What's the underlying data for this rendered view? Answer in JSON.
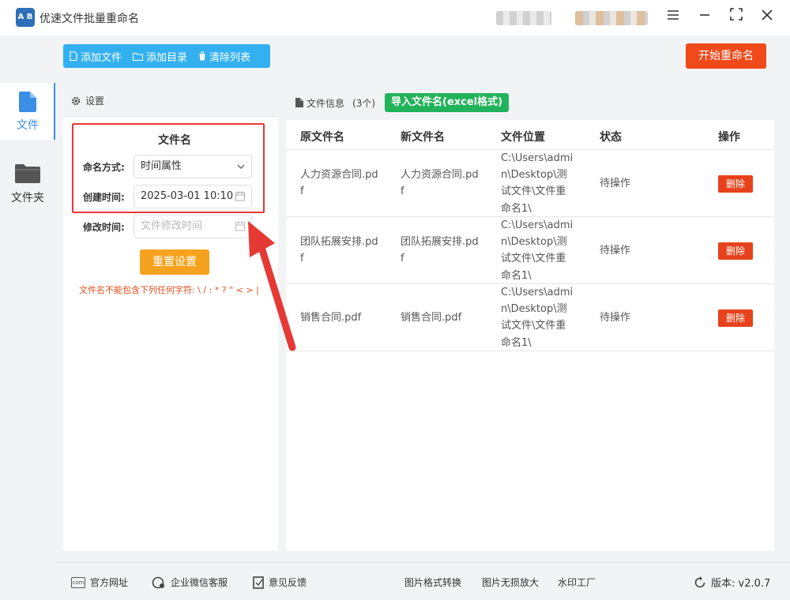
{
  "app": {
    "title": "优速文件批量重命名",
    "logo_text": "A B",
    "accent": "#3a8ee6"
  },
  "window_controls": [
    "menu-icon",
    "minimize-icon",
    "maximize-icon",
    "close-icon"
  ],
  "rail": {
    "items": [
      {
        "label": "文件",
        "icon": "file-icon",
        "active": true
      },
      {
        "label": "文件夹",
        "icon": "folder-icon",
        "active": false
      }
    ]
  },
  "toolbar": {
    "add_file": "添加文件",
    "add_dir": "添加目录",
    "clear_list": "清除列表",
    "start": "开始重命名",
    "color": "#33b0f0",
    "start_color": "#f04a1a"
  },
  "settings": {
    "header": "设置",
    "section_title": "文件名",
    "naming_mode_label": "命名方式:",
    "naming_mode_value": "时间属性",
    "create_time_label": "创建时间:",
    "create_time_value": "2025-03-01 10:10",
    "modify_time_label": "修改时间:",
    "modify_time_placeholder": "文件修改时间",
    "reset_button": "重置设置",
    "warning": "文件名不能包含下列任何字符: \\ / : * ? \" < > |"
  },
  "files": {
    "header_label": "文件信息",
    "count": "(3个)",
    "import_button": "导入文件名(excel格式)",
    "columns": [
      "原文件名",
      "新文件名",
      "文件位置",
      "状态",
      "操作"
    ],
    "rows": [
      {
        "original": "人力资源合同.pdf",
        "new": "人力资源合同.pdf",
        "location": "C:\\Users\\admin\\Desktop\\测试文件\\文件重命名1\\",
        "status": "待操作",
        "action": "删除"
      },
      {
        "original": "团队拓展安排.pdf",
        "new": "团队拓展安排.pdf",
        "location": "C:\\Users\\admin\\Desktop\\测试文件\\文件重命名1\\",
        "status": "待操作",
        "action": "删除"
      },
      {
        "original": "销售合同.pdf",
        "new": "销售合同.pdf",
        "location": "C:\\Users\\admin\\Desktop\\测试文件\\文件重命名1\\",
        "status": "待操作",
        "action": "删除"
      }
    ]
  },
  "footer": {
    "website": "官方网址",
    "wechat_support": "企业微信客服",
    "feedback": "意见反馈",
    "image_convert": "图片格式转换",
    "image_enlarge": "图片无损放大",
    "watermark": "水印工厂",
    "version": "版本: v2.0.7"
  }
}
